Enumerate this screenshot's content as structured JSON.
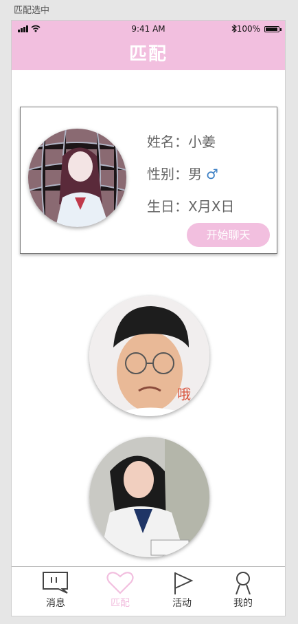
{
  "page_label": "匹配选中",
  "status_bar": {
    "time": "9:41 AM",
    "battery": "100%"
  },
  "header": {
    "title": "匹配"
  },
  "profile": {
    "name_label": "姓名：",
    "name": "小姜",
    "gender_label": "性别：",
    "gender": "男",
    "birthday_label": "生日：",
    "birthday": "X月X日",
    "chat_button": "开始聊天"
  },
  "recommendation": {
    "exclaim": "哦"
  },
  "tabbar": {
    "items": [
      {
        "label": "消息",
        "icon": "message-icon"
      },
      {
        "label": "匹配",
        "icon": "heart-icon",
        "active": true
      },
      {
        "label": "活动",
        "icon": "flag-icon"
      },
      {
        "label": "我的",
        "icon": "person-icon"
      }
    ]
  },
  "colors": {
    "accent": "#f2bfdf",
    "male": "#3b7fc4"
  }
}
